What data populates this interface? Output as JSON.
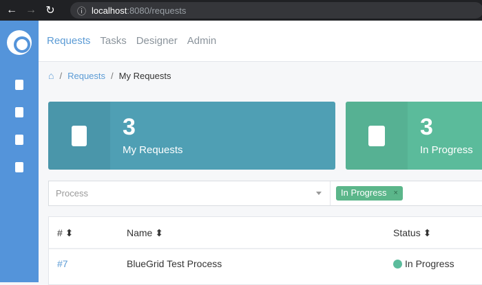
{
  "browser": {
    "url_host": "localhost",
    "url_path": ":8080/requests"
  },
  "nav": {
    "items": [
      {
        "label": "Requests",
        "active": true
      },
      {
        "label": "Tasks"
      },
      {
        "label": "Designer"
      },
      {
        "label": "Admin"
      }
    ]
  },
  "breadcrumb": {
    "items": [
      "Requests",
      "My Requests"
    ]
  },
  "cards": [
    {
      "count": "3",
      "label": "My Requests",
      "color": "#4f9fb4",
      "icon": "id-badge-icon"
    },
    {
      "count": "3",
      "label": "In Progress",
      "color": "#5bbb9b",
      "icon": "clipboard-list-icon"
    }
  ],
  "filter": {
    "process_placeholder": "Process",
    "status_tag": "In Progress",
    "remove": "×"
  },
  "table": {
    "columns": [
      "#",
      "Name",
      "Status"
    ],
    "rows": [
      {
        "id": "#7",
        "name": "BlueGrid Test Process",
        "status": "In Progress",
        "status_color": "#5bbc9c"
      }
    ]
  }
}
